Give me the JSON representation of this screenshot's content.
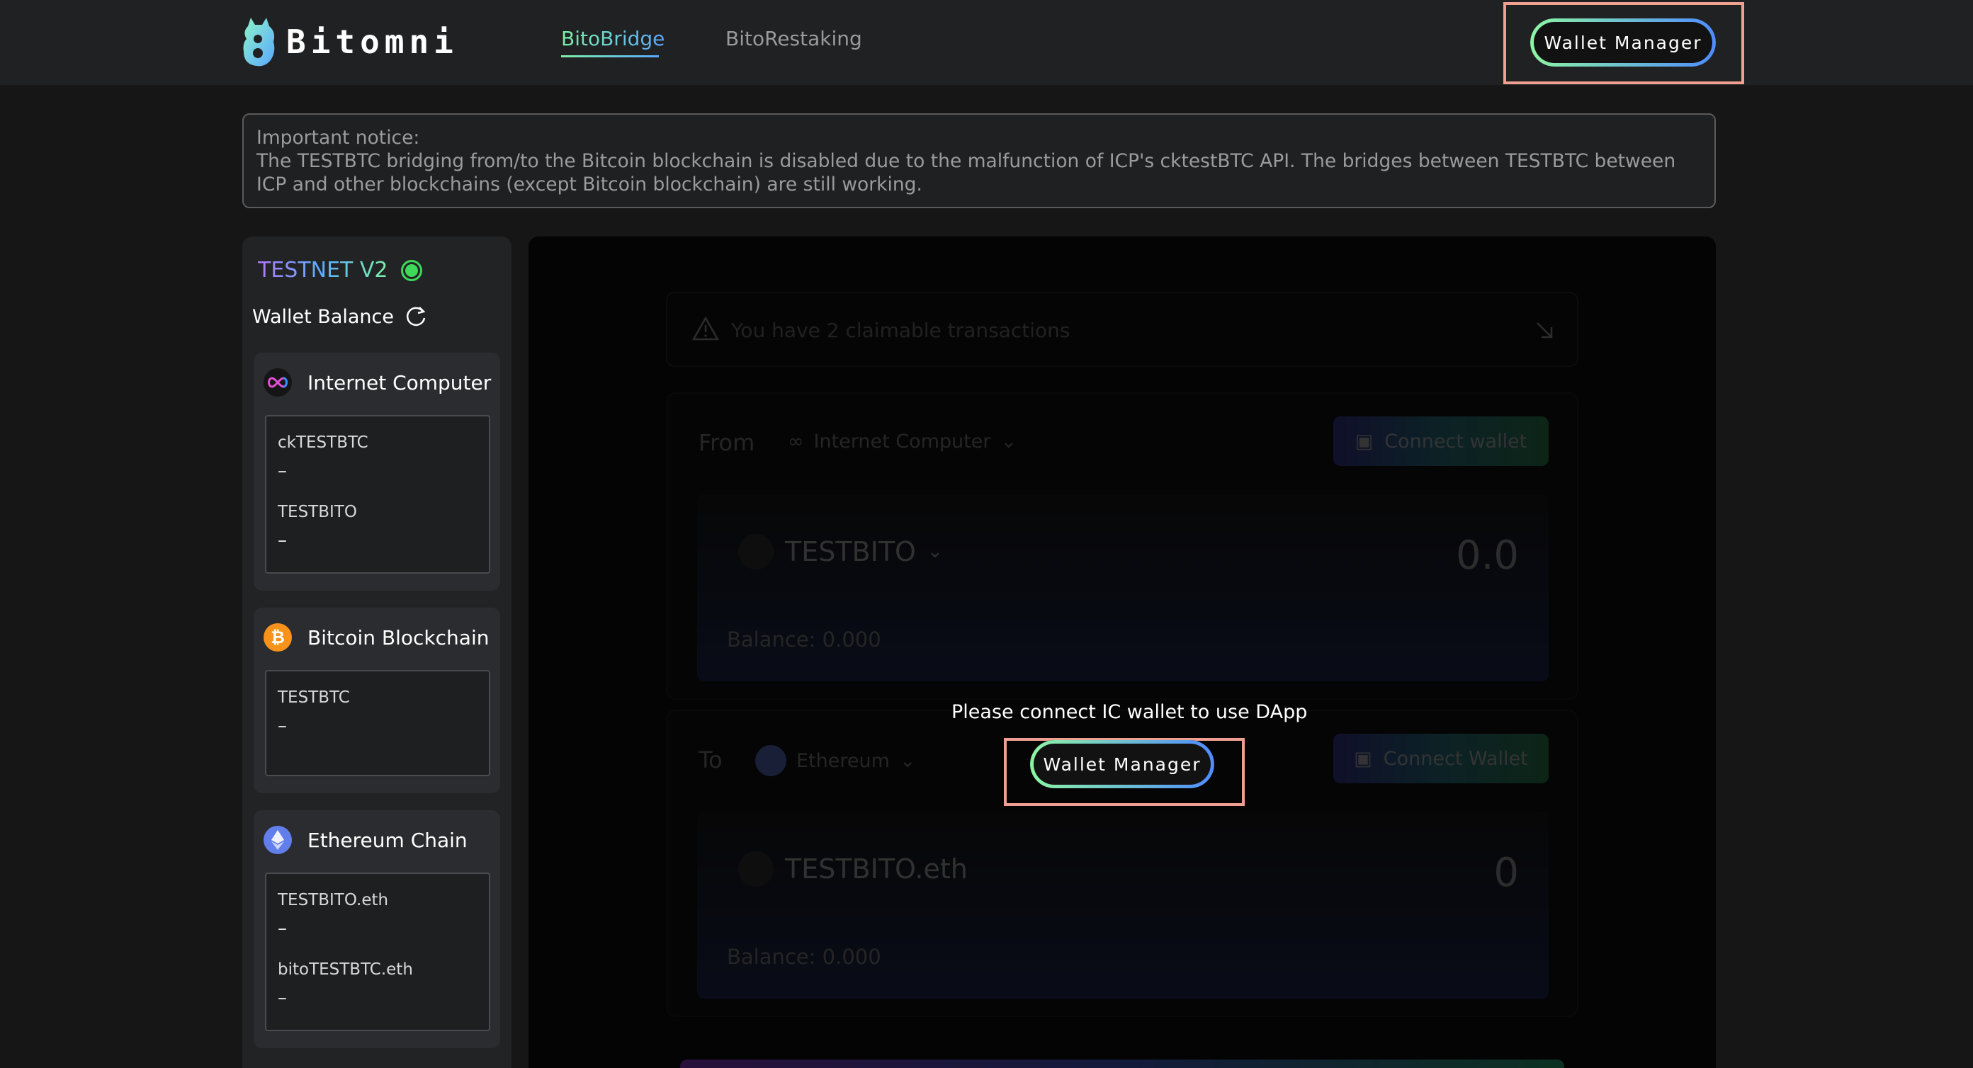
{
  "header": {
    "brand": "Bitomni",
    "nav": [
      "BitoBridge",
      "BitoRestaking"
    ],
    "wallet_manager": "Wallet Manager"
  },
  "notice": {
    "title": "Important notice:",
    "body": "The TESTBTC bridging from/to the Bitcoin blockchain is disabled due to the malfunction of ICP's cktestBTC API. The bridges between TESTBTC between ICP and other blockchains (except Bitcoin blockchain) are still working."
  },
  "sidebar": {
    "network": "TESTNET V2",
    "wallet_balance": "Wallet Balance",
    "chains": [
      {
        "name": "Internet Computer",
        "icon": "infinity-icon",
        "tokens": [
          {
            "name": "ckTESTBTC",
            "value": "–"
          },
          {
            "name": "TESTBITO",
            "value": "–"
          }
        ]
      },
      {
        "name": "Bitcoin Blockchain",
        "icon": "bitcoin-icon",
        "color": "#f7931a",
        "tokens": [
          {
            "name": "TESTBTC",
            "value": "–"
          }
        ]
      },
      {
        "name": "Ethereum Chain",
        "icon": "ethereum-icon",
        "color": "#627eea",
        "tokens": [
          {
            "name": "TESTBITO.eth",
            "value": "–"
          },
          {
            "name": "bitoTESTBTC.eth",
            "value": "–"
          }
        ]
      }
    ]
  },
  "main": {
    "claim_notice": "You have 2 claimable transactions",
    "from": {
      "label": "From",
      "chain": "Internet Computer",
      "connect": "Connect wallet",
      "token": "TESTBITO",
      "amount": "0.0",
      "balance": "Balance: 0.000"
    },
    "to": {
      "label": "To",
      "chain": "Ethereum",
      "connect": "Connect Wallet",
      "token": "TESTBITO.eth",
      "amount": "0",
      "balance": "Balance: 0.000"
    },
    "connect_message": "Please connect IC wallet to use DApp",
    "wallet_manager": "Wallet Manager"
  },
  "colors": {
    "accent_start": "#8df5a3",
    "accent_end": "#4f8cff",
    "highlight": "#f0a090",
    "status": "#3ed85a"
  }
}
